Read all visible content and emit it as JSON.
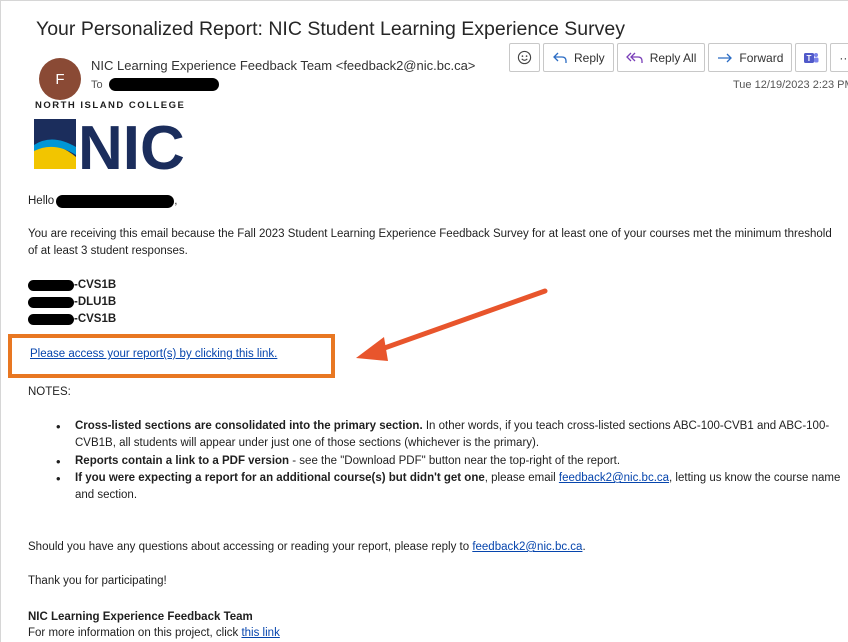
{
  "email": {
    "subject": "Your Personalized Report: NIC Student Learning Experience Survey",
    "avatar_initial": "F",
    "sender": "NIC Learning Experience Feedback Team <feedback2@nic.bc.ca>",
    "to_label": "To",
    "date": "Tue 12/19/2023 2:23 PM"
  },
  "toolbar": {
    "reply": "Reply",
    "reply_all": "Reply All",
    "forward": "Forward",
    "more": "···"
  },
  "logo": {
    "top_text": "NORTH ISLAND COLLEGE",
    "wordmark": "NIC",
    "colors": {
      "navy": "#1b2d5c",
      "yellow": "#f2c500",
      "blue": "#0096d6"
    }
  },
  "body": {
    "greeting_prefix": "Hello",
    "greeting_suffix": ",",
    "intro": "You are receiving this email because the Fall 2023 Student Learning Experience Feedback Survey for at least one of your courses met the minimum threshold of at least 3 student responses.",
    "courses": [
      "-CVS1B",
      "-DLU1B",
      "-CVS1B"
    ],
    "report_link": "Please access your report(s) by clicking this link.",
    "notes_heading": "NOTES:",
    "notes": [
      {
        "bold": "Cross-listed sections are consolidated into the primary section.",
        "text": "  In other words, if you teach cross-listed sections ABC-100-CVB1 and ABC-100-CVB1B, all students will appear under just one of those sections (whichever is the primary)."
      },
      {
        "bold": "Reports contain a link to a PDF version",
        "text": " - see the \"Download PDF\" button near the top-right of the report."
      },
      {
        "bold": "If you were expecting a report for an additional course(s) but didn't get one",
        "text_before": ", please email ",
        "link": "feedback2@nic.bc.ca",
        "text_after": ", letting us know the course name and section."
      }
    ],
    "questions_prefix": "Should you have any questions about accessing or reading your report, please reply to ",
    "questions_link": "feedback2@nic.bc.ca",
    "questions_suffix": ".",
    "thanks": "Thank you for participating!",
    "signature_name": "NIC Learning Experience Feedback Team",
    "more_info_prefix": "For more information on this project, click ",
    "more_info_link": "this link"
  },
  "annotation": {
    "box_color": "#e87722",
    "arrow_color": "#e8552c"
  }
}
